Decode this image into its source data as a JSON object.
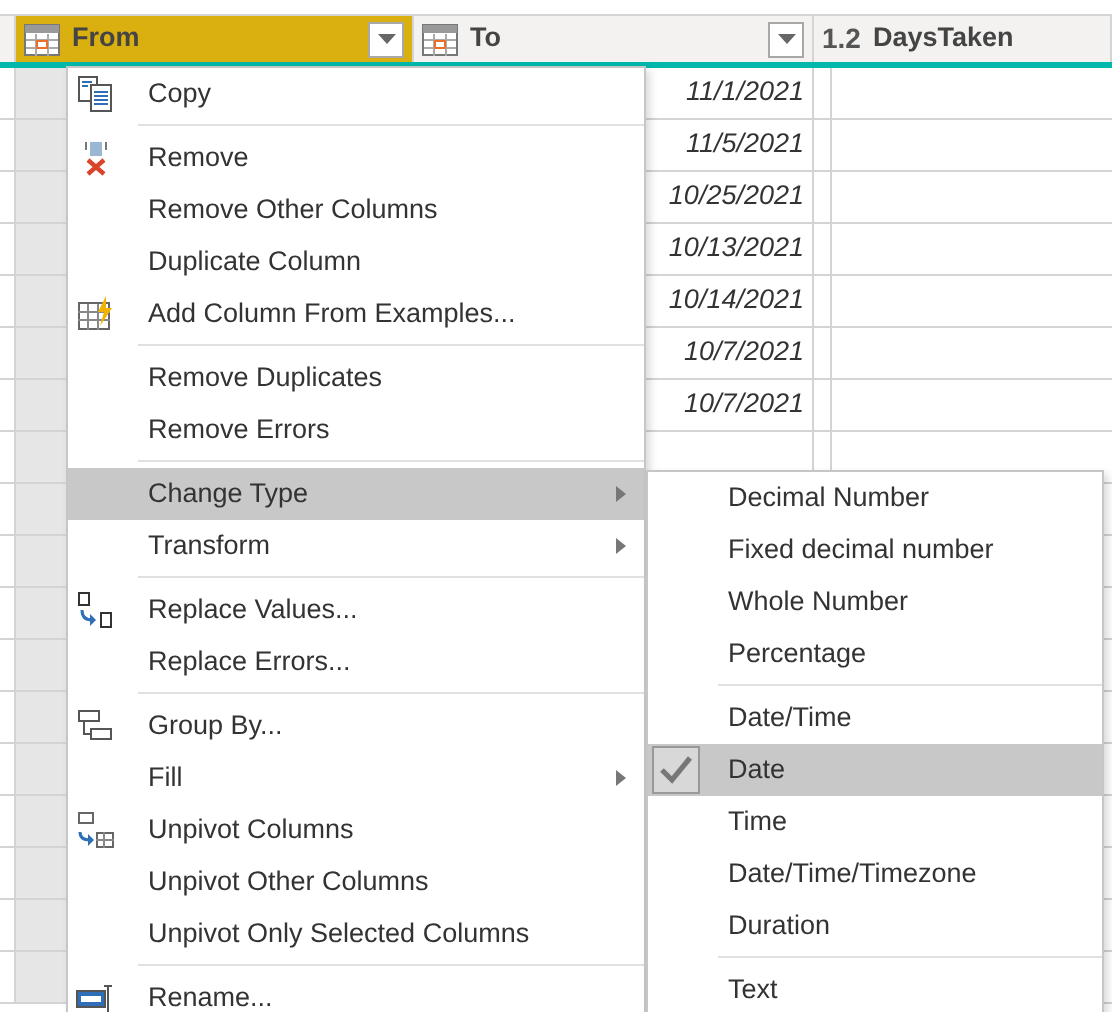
{
  "table": {
    "columns": [
      {
        "label": "From",
        "kind": "date",
        "selected": true,
        "dropdown": true
      },
      {
        "label": "To",
        "kind": "date",
        "selected": false,
        "dropdown": true
      },
      {
        "label": "DaysTaken",
        "kind": "number",
        "type_label": "1.2",
        "selected": false,
        "dropdown": false
      }
    ],
    "rows": [
      {
        "to": "11/1/2021"
      },
      {
        "to": "11/5/2021"
      },
      {
        "to": "10/25/2021"
      },
      {
        "to": "10/13/2021"
      },
      {
        "to": "10/14/2021"
      },
      {
        "to": "10/7/2021"
      },
      {
        "to": "10/7/2021"
      }
    ]
  },
  "context_menu": {
    "groups": [
      [
        {
          "label": "Copy",
          "submenu": false,
          "selected": false
        }
      ],
      [
        {
          "label": "Remove",
          "submenu": false,
          "selected": false
        },
        {
          "label": "Remove Other Columns",
          "submenu": false,
          "selected": false
        },
        {
          "label": "Duplicate Column",
          "submenu": false,
          "selected": false
        },
        {
          "label": "Add Column From Examples...",
          "submenu": false,
          "selected": false
        }
      ],
      [
        {
          "label": "Remove Duplicates",
          "submenu": false,
          "selected": false
        },
        {
          "label": "Remove Errors",
          "submenu": false,
          "selected": false
        }
      ],
      [
        {
          "label": "Change Type",
          "submenu": true,
          "selected": true
        },
        {
          "label": "Transform",
          "submenu": true,
          "selected": false
        }
      ],
      [
        {
          "label": "Replace Values...",
          "submenu": false,
          "selected": false
        },
        {
          "label": "Replace Errors...",
          "submenu": false,
          "selected": false
        }
      ],
      [
        {
          "label": "Group By...",
          "submenu": false,
          "selected": false
        },
        {
          "label": "Fill",
          "submenu": true,
          "selected": false
        },
        {
          "label": "Unpivot Columns",
          "submenu": false,
          "selected": false
        },
        {
          "label": "Unpivot Other Columns",
          "submenu": false,
          "selected": false
        },
        {
          "label": "Unpivot Only Selected Columns",
          "submenu": false,
          "selected": false
        }
      ],
      [
        {
          "label": "Rename...",
          "submenu": false,
          "selected": false
        }
      ]
    ]
  },
  "type_submenu": {
    "groups": [
      [
        {
          "label": "Decimal Number",
          "checked": false,
          "selected": false
        },
        {
          "label": "Fixed decimal number",
          "checked": false,
          "selected": false
        },
        {
          "label": "Whole Number",
          "checked": false,
          "selected": false
        },
        {
          "label": "Percentage",
          "checked": false,
          "selected": false
        }
      ],
      [
        {
          "label": "Date/Time",
          "checked": false,
          "selected": false
        },
        {
          "label": "Date",
          "checked": true,
          "selected": true
        },
        {
          "label": "Time",
          "checked": false,
          "selected": false
        },
        {
          "label": "Date/Time/Timezone",
          "checked": false,
          "selected": false
        },
        {
          "label": "Duration",
          "checked": false,
          "selected": false
        }
      ],
      [
        {
          "label": "Text",
          "checked": false,
          "selected": false
        }
      ]
    ]
  }
}
